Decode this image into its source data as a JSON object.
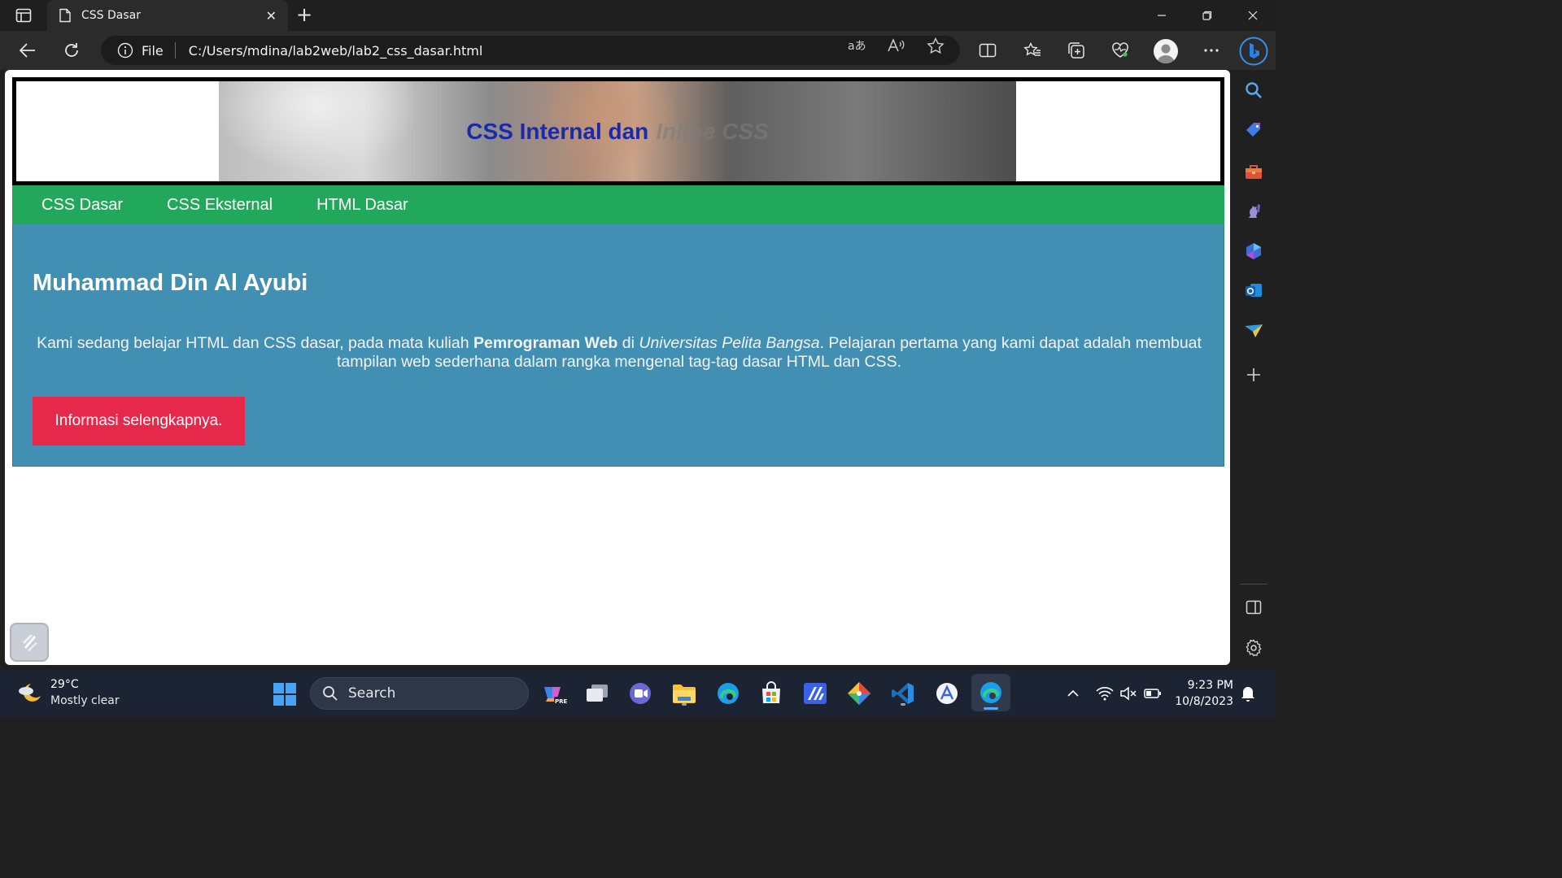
{
  "browser": {
    "tab_title": "CSS Dasar",
    "tab_close": "✕",
    "new_tab": "+",
    "address_scheme_label": "File",
    "address_url": "C:/Users/mdina/lab2web/lab2_css_dasar.html"
  },
  "page": {
    "header": {
      "title_main": "CSS Internal dan",
      "title_faded": "Inline CSS"
    },
    "nav": [
      {
        "label": "CSS Dasar"
      },
      {
        "label": "CSS Eksternal"
      },
      {
        "label": "HTML Dasar"
      }
    ],
    "hero": {
      "heading": "Muhammad Din Al Ayubi",
      "text_before": "Kami sedang belajar HTML dan CSS dasar, pada mata kuliah ",
      "text_bold": "Pemrograman Web",
      "text_middle": " di ",
      "text_italic": "Universitas Pelita Bangsa",
      "text_after": ". Pelajaran pertama yang kami dapat adalah membuat tampilan web sederhana dalam rangka mengenal tag-tag dasar HTML dan CSS.",
      "button_label": "Informasi selengkapnya."
    }
  },
  "taskbar": {
    "weather_temp": "29°C",
    "weather_condition": "Mostly clear",
    "search_label": "Search",
    "time": "9:23 PM",
    "date": "10/8/2023"
  },
  "colors": {
    "header_title": "#1b2aa8",
    "nav_background": "#22a85a",
    "hero_background": "#418fb3",
    "button_background": "#e6294b"
  }
}
